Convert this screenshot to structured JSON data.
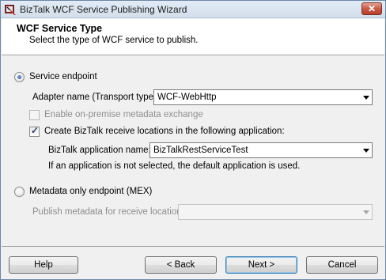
{
  "window": {
    "title": "BizTalk WCF Service Publishing Wizard"
  },
  "header": {
    "title": "WCF Service Type",
    "subtitle": "Select the type of WCF service to publish."
  },
  "service_endpoint": {
    "label": "Service endpoint",
    "selected": true,
    "adapter_label": "Adapter name (Transport type):",
    "adapter_value": "WCF-WebHttp",
    "onpremise_label": "Enable on-premise metadata exchange",
    "onpremise_checked": false,
    "create_locations_label": "Create BizTalk receive locations in the following application:",
    "create_locations_checked": true,
    "app_name_label": "BizTalk application name:",
    "app_name_value": "BizTalkRestServiceTest",
    "note": "If an application is not selected, the default application is used."
  },
  "metadata_endpoint": {
    "label": "Metadata only endpoint (MEX)",
    "selected": false,
    "publish_label": "Publish metadata for receive location:",
    "publish_value": ""
  },
  "buttons": {
    "help": "Help",
    "back": "< Back",
    "next": "Next >",
    "cancel": "Cancel"
  },
  "colors": {
    "header_bg": "#ffffff",
    "dialog_bg": "#f0f0f0",
    "close_button": "#c75a45"
  }
}
